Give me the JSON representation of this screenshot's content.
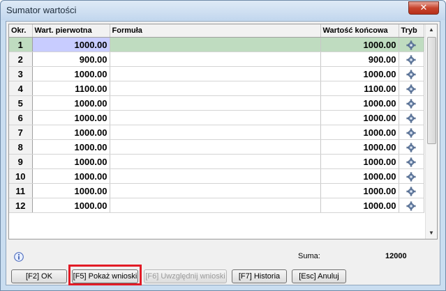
{
  "window": {
    "title": "Sumator wartości",
    "close_glyph": "✕"
  },
  "table": {
    "headers": {
      "okr": "Okr.",
      "pierwotna": "Wart. pierwotna",
      "formula": "Formuła",
      "koncowa": "Wartość końcowa",
      "tryb": "Tryb"
    },
    "rows": [
      {
        "okr": "1",
        "pierwotna": "1000.00",
        "formula": "",
        "koncowa": "1000.00",
        "tryb": "gear-icon"
      },
      {
        "okr": "2",
        "pierwotna": "900.00",
        "formula": "",
        "koncowa": "900.00",
        "tryb": "gear-icon"
      },
      {
        "okr": "3",
        "pierwotna": "1000.00",
        "formula": "",
        "koncowa": "1000.00",
        "tryb": "gear-icon"
      },
      {
        "okr": "4",
        "pierwotna": "1100.00",
        "formula": "",
        "koncowa": "1100.00",
        "tryb": "gear-icon"
      },
      {
        "okr": "5",
        "pierwotna": "1000.00",
        "formula": "",
        "koncowa": "1000.00",
        "tryb": "gear-icon"
      },
      {
        "okr": "6",
        "pierwotna": "1000.00",
        "formula": "",
        "koncowa": "1000.00",
        "tryb": "gear-icon"
      },
      {
        "okr": "7",
        "pierwotna": "1000.00",
        "formula": "",
        "koncowa": "1000.00",
        "tryb": "gear-icon"
      },
      {
        "okr": "8",
        "pierwotna": "1000.00",
        "formula": "",
        "koncowa": "1000.00",
        "tryb": "gear-icon"
      },
      {
        "okr": "9",
        "pierwotna": "1000.00",
        "formula": "",
        "koncowa": "1000.00",
        "tryb": "gear-icon"
      },
      {
        "okr": "10",
        "pierwotna": "1000.00",
        "formula": "",
        "koncowa": "1000.00",
        "tryb": "gear-icon"
      },
      {
        "okr": "11",
        "pierwotna": "1000.00",
        "formula": "",
        "koncowa": "1000.00",
        "tryb": "gear-icon"
      },
      {
        "okr": "12",
        "pierwotna": "1000.00",
        "formula": "",
        "koncowa": "1000.00",
        "tryb": "gear-icon"
      }
    ]
  },
  "footer": {
    "suma_label": "Suma:",
    "suma_value": "12000"
  },
  "buttons": {
    "ok": "[F2] OK",
    "pokaz": "[F5] Pokaż wnioski",
    "uwzglednij": "[F6] Uwzględnij wnioski",
    "historia": "[F7] Historia",
    "anuluj": "[Esc] Anuluj"
  },
  "colors": {
    "highlight": "#e21b26",
    "selected_row": "#bfdcc0",
    "selected_cell": "#c8ccff"
  }
}
